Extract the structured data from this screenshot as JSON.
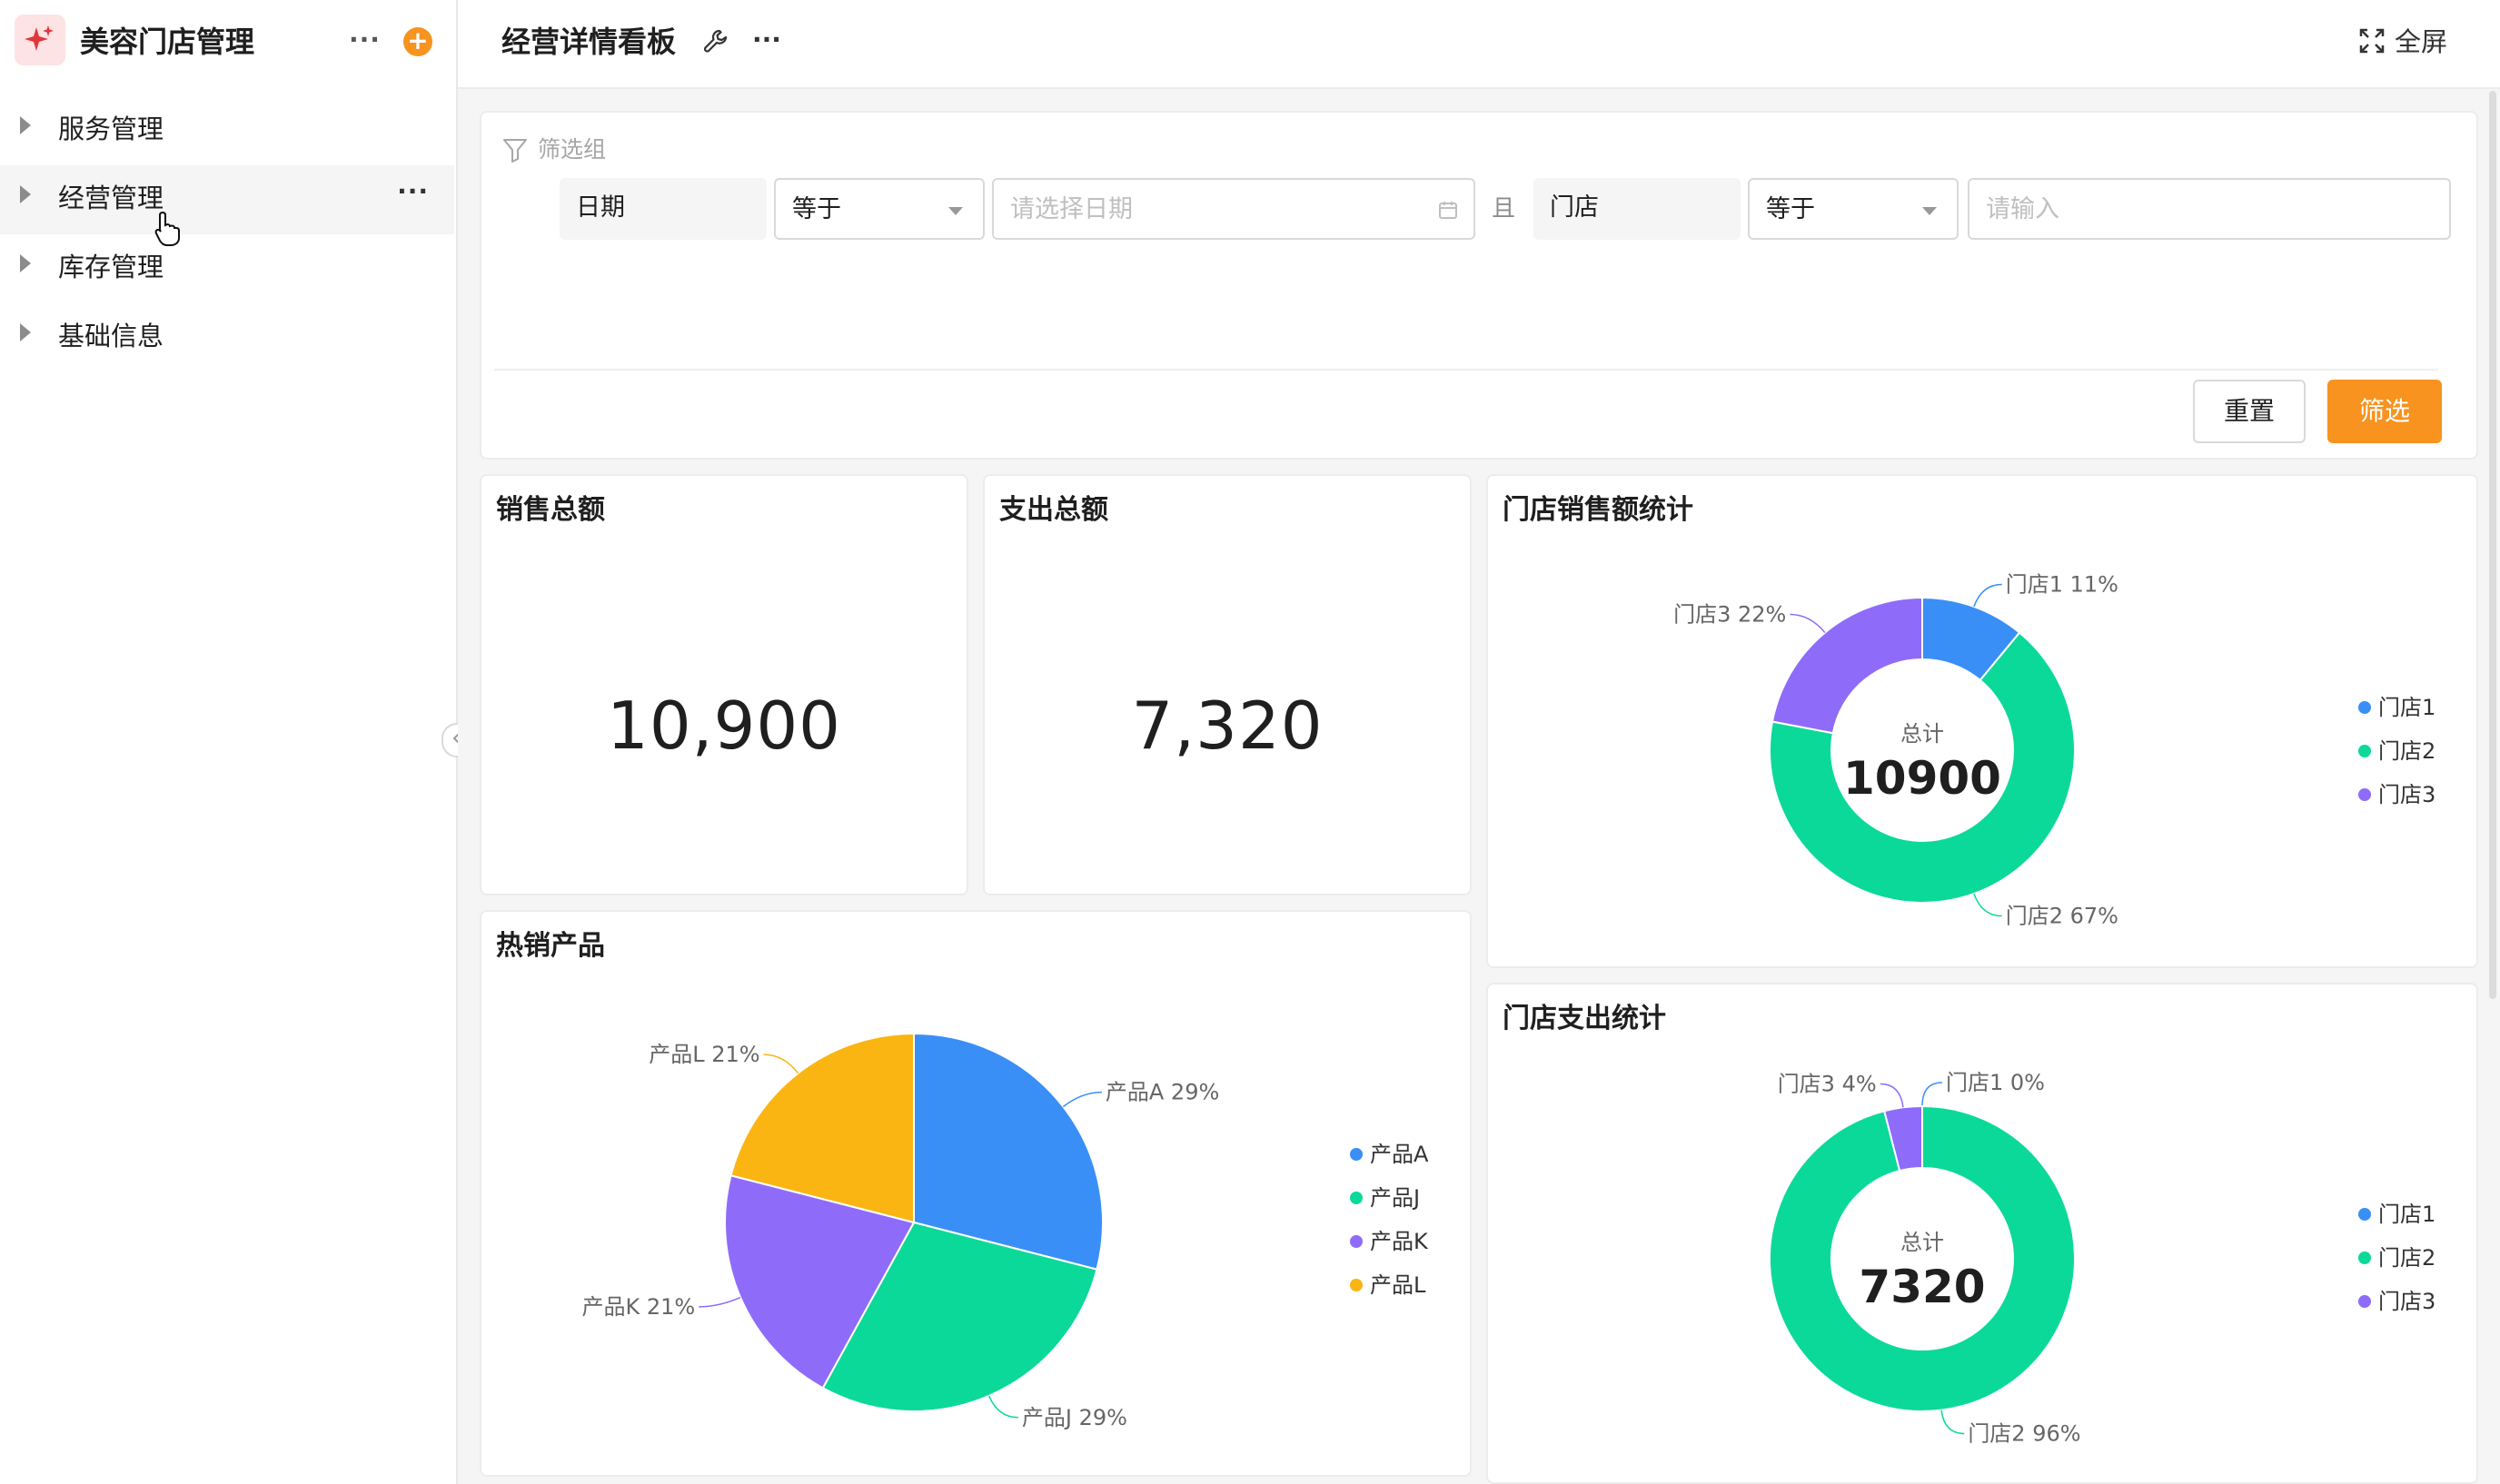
{
  "app": {
    "title": "美容门店管理",
    "more": "···",
    "add": "+"
  },
  "sidebar": {
    "items": [
      {
        "label": "服务管理"
      },
      {
        "label": "经营管理",
        "more": "···"
      },
      {
        "label": "库存管理"
      },
      {
        "label": "基础信息"
      }
    ]
  },
  "header": {
    "title": "经营详情看板",
    "more": "···",
    "fullscreen": "全屏"
  },
  "filter": {
    "title": "筛选组",
    "date_label": "日期",
    "date_op": "等于",
    "date_placeholder": "请选择日期",
    "and": "且",
    "store_label": "门店",
    "store_op": "等于",
    "store_placeholder": "请输入",
    "reset": "重置",
    "submit": "筛选"
  },
  "kpis": {
    "sales": {
      "title": "销售总额",
      "value": "10,900"
    },
    "expense": {
      "title": "支出总额",
      "value": "7,320"
    }
  },
  "colors": {
    "accent": "#f7931e",
    "blue": "#3a8ff7",
    "green": "#0bd999",
    "purple": "#8e6cf9",
    "yellow": "#fab512"
  },
  "chart_data": [
    {
      "type": "pie",
      "title": "热销产品",
      "categories": [
        "产品A",
        "产品J",
        "产品K",
        "产品L"
      ],
      "values": [
        29,
        29,
        21,
        21
      ],
      "slice_labels": [
        "产品A 29%",
        "产品J 29%",
        "产品K 21%",
        "产品L 21%"
      ],
      "colors": [
        "#3a8ff7",
        "#0bd999",
        "#8e6cf9",
        "#fab512"
      ],
      "legend": "right"
    },
    {
      "type": "pie",
      "title": "门店销售额统计",
      "categories": [
        "门店1",
        "门店2",
        "门店3"
      ],
      "values": [
        11,
        67,
        22
      ],
      "slice_labels": [
        "门店1 11%",
        "门店2 67%",
        "门店3 22%"
      ],
      "center_label": "总计",
      "center_value": "10900",
      "colors": [
        "#3a8ff7",
        "#0bd999",
        "#8e6cf9"
      ],
      "legend": "right"
    },
    {
      "type": "pie",
      "title": "门店支出统计",
      "categories": [
        "门店1",
        "门店2",
        "门店3"
      ],
      "values": [
        0,
        96,
        4
      ],
      "slice_labels": [
        "门店1 0%",
        "门店2 96%",
        "门店3 4%"
      ],
      "center_label": "总计",
      "center_value": "7320",
      "colors": [
        "#3a8ff7",
        "#0bd999",
        "#8e6cf9"
      ],
      "legend": "right"
    }
  ]
}
